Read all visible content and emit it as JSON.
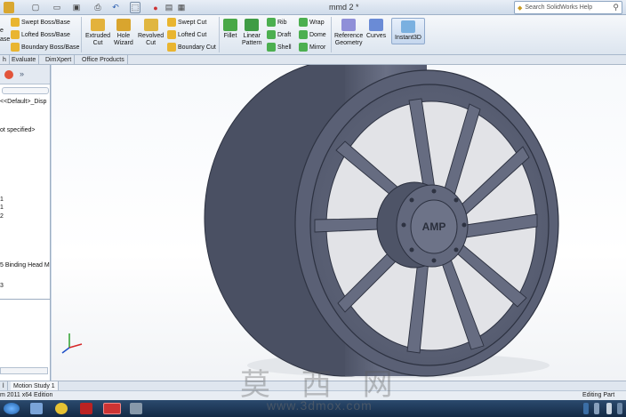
{
  "window": {
    "title": "mmd 2 *",
    "help_placeholder": "Search SolidWorks Help"
  },
  "ribbon": {
    "swept_boss": "Swept Boss/Base",
    "lofted_boss": "Lofted Boss/Base",
    "boundary_boss": "Boundary Boss/Base",
    "left_partial_1": "e",
    "left_partial_2": "ase",
    "extruded_cut_1": "Extruded",
    "extruded_cut_2": "Cut",
    "hole_wizard_1": "Hole",
    "hole_wizard_2": "Wizard",
    "revolved_cut_1": "Revolved",
    "revolved_cut_2": "Cut",
    "swept_cut": "Swept Cut",
    "lofted_cut": "Lofted Cut",
    "boundary_cut": "Boundary Cut",
    "fillet": "Fillet",
    "linear_pattern_1": "Linear",
    "linear_pattern_2": "Pattern",
    "rib": "Rib",
    "draft": "Draft",
    "shell": "Shell",
    "wrap": "Wrap",
    "dome": "Dome",
    "mirror": "Mirror",
    "reference_geometry_1": "Reference",
    "reference_geometry_2": "Geometry",
    "curves": "Curves",
    "instant3d": "Instant3D"
  },
  "command_tabs": [
    "h",
    "Evaluate",
    "DimXpert",
    "Office Products"
  ],
  "feature_tree": {
    "items": [
      "<<Default>_Disp",
      "ot specified>",
      "1",
      "1",
      "2",
      "5 Binding Head M",
      "3"
    ]
  },
  "bottom_tabs": [
    "l",
    "Motion Study 1"
  ],
  "status": {
    "left": "m 2011 x64 Edition",
    "right": "Editing Part"
  },
  "watermark": {
    "chars": "莫 西 网",
    "url": "www.3dmox.com"
  },
  "viewport": {
    "logo_text": "AMP"
  },
  "colors": {
    "wheel": "#5e6478",
    "background": "#ffffff",
    "ribbon": "#dce5ef"
  }
}
